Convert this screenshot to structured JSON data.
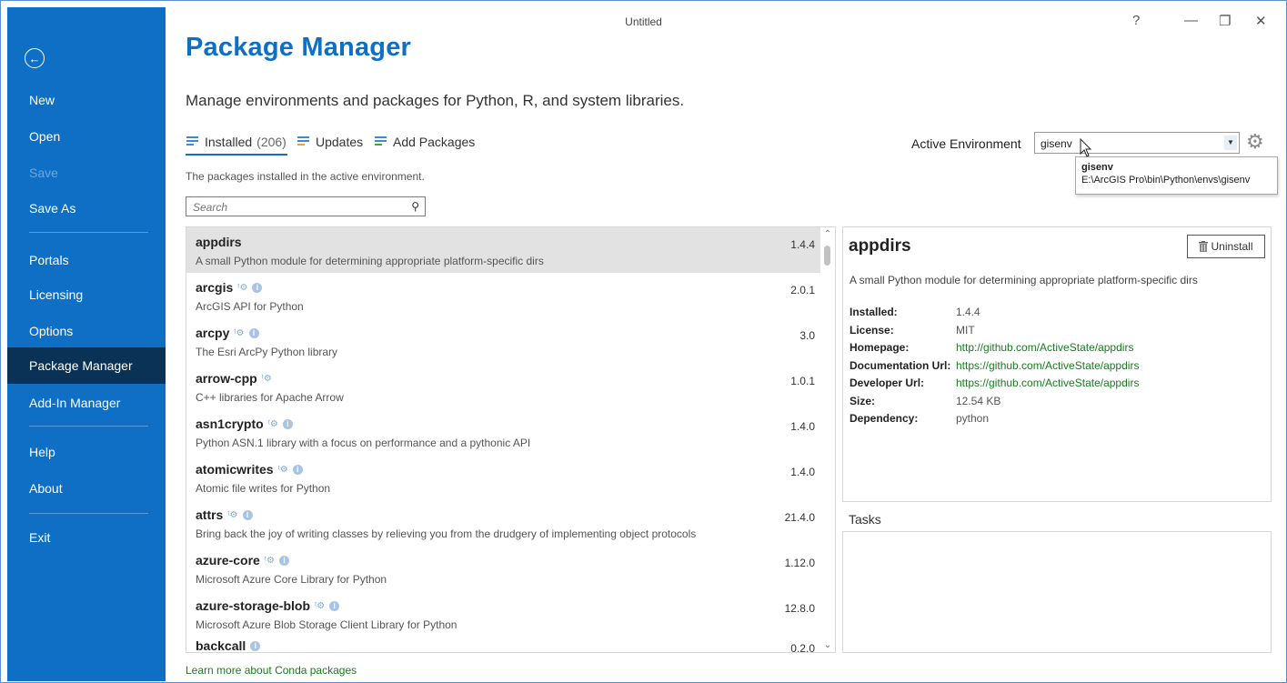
{
  "window": {
    "title": "Untitled",
    "help": "?",
    "minimize": "—",
    "restore": "❐",
    "close": "✕"
  },
  "sidebar": {
    "items": [
      {
        "label": "New"
      },
      {
        "label": "Open"
      },
      {
        "label": "Save"
      },
      {
        "label": "Save As"
      },
      {
        "label": "Portals"
      },
      {
        "label": "Licensing"
      },
      {
        "label": "Options"
      },
      {
        "label": "Package Manager"
      },
      {
        "label": "Add-In Manager"
      },
      {
        "label": "Help"
      },
      {
        "label": "About"
      },
      {
        "label": "Exit"
      }
    ]
  },
  "main": {
    "title": "Package Manager",
    "subtitle": "Manage environments and packages for Python, R, and system libraries.",
    "tabs": [
      {
        "label": "Installed",
        "count": "(206)"
      },
      {
        "label": "Updates"
      },
      {
        "label": "Add Packages"
      }
    ],
    "tab_description": "The packages installed in the active environment.",
    "search_placeholder": "Search",
    "learn_more": "Learn more about Conda packages"
  },
  "environment": {
    "label": "Active Environment",
    "value": "gisenv",
    "tooltip_name": "gisenv",
    "tooltip_path": "E:\\ArcGIS Pro\\bin\\Python\\envs\\gisenv"
  },
  "packages": [
    {
      "name": "appdirs",
      "desc": "A small Python module for determining appropriate platform-specific dirs",
      "version": "1.4.4",
      "conda": false,
      "info": false
    },
    {
      "name": "arcgis",
      "desc": "ArcGIS API for Python",
      "version": "2.0.1",
      "conda": true,
      "info": true
    },
    {
      "name": "arcpy",
      "desc": "The Esri ArcPy Python library",
      "version": "3.0",
      "conda": true,
      "info": true
    },
    {
      "name": "arrow-cpp",
      "desc": "C++ libraries for Apache Arrow",
      "version": "1.0.1",
      "conda": true,
      "info": false
    },
    {
      "name": "asn1crypto",
      "desc": "Python ASN.1 library with a focus on performance and a pythonic API",
      "version": "1.4.0",
      "conda": true,
      "info": true
    },
    {
      "name": "atomicwrites",
      "desc": "Atomic file writes for Python",
      "version": "1.4.0",
      "conda": true,
      "info": true
    },
    {
      "name": "attrs",
      "desc": "Bring back the joy of writing classes by relieving you from the drudgery of implementing object protocols",
      "version": "21.4.0",
      "conda": true,
      "info": true
    },
    {
      "name": "azure-core",
      "desc": "Microsoft Azure Core Library for Python",
      "version": "1.12.0",
      "conda": true,
      "info": true
    },
    {
      "name": "azure-storage-blob",
      "desc": "Microsoft Azure Blob Storage Client Library for Python",
      "version": "12.8.0",
      "conda": true,
      "info": true
    },
    {
      "name": "backcall",
      "desc": "",
      "version": "0.2.0",
      "conda": false,
      "info": true
    }
  ],
  "detail": {
    "name": "appdirs",
    "uninstall": "Uninstall",
    "description": "A small Python module for determining appropriate platform-specific dirs",
    "fields": [
      {
        "label": "Installed:",
        "value": "1.4.4",
        "link": false
      },
      {
        "label": "License:",
        "value": "MIT",
        "link": false
      },
      {
        "label": "Homepage:",
        "value": "http://github.com/ActiveState/appdirs",
        "link": true
      },
      {
        "label": "Documentation Url:",
        "value": "https://github.com/ActiveState/appdirs",
        "link": true
      },
      {
        "label": "Developer Url:",
        "value": "https://github.com/ActiveState/appdirs",
        "link": true
      },
      {
        "label": "Size:",
        "value": "12.54 KB",
        "link": false
      },
      {
        "label": "Dependency:",
        "value": "python",
        "link": false
      }
    ],
    "tasks_label": "Tasks"
  }
}
